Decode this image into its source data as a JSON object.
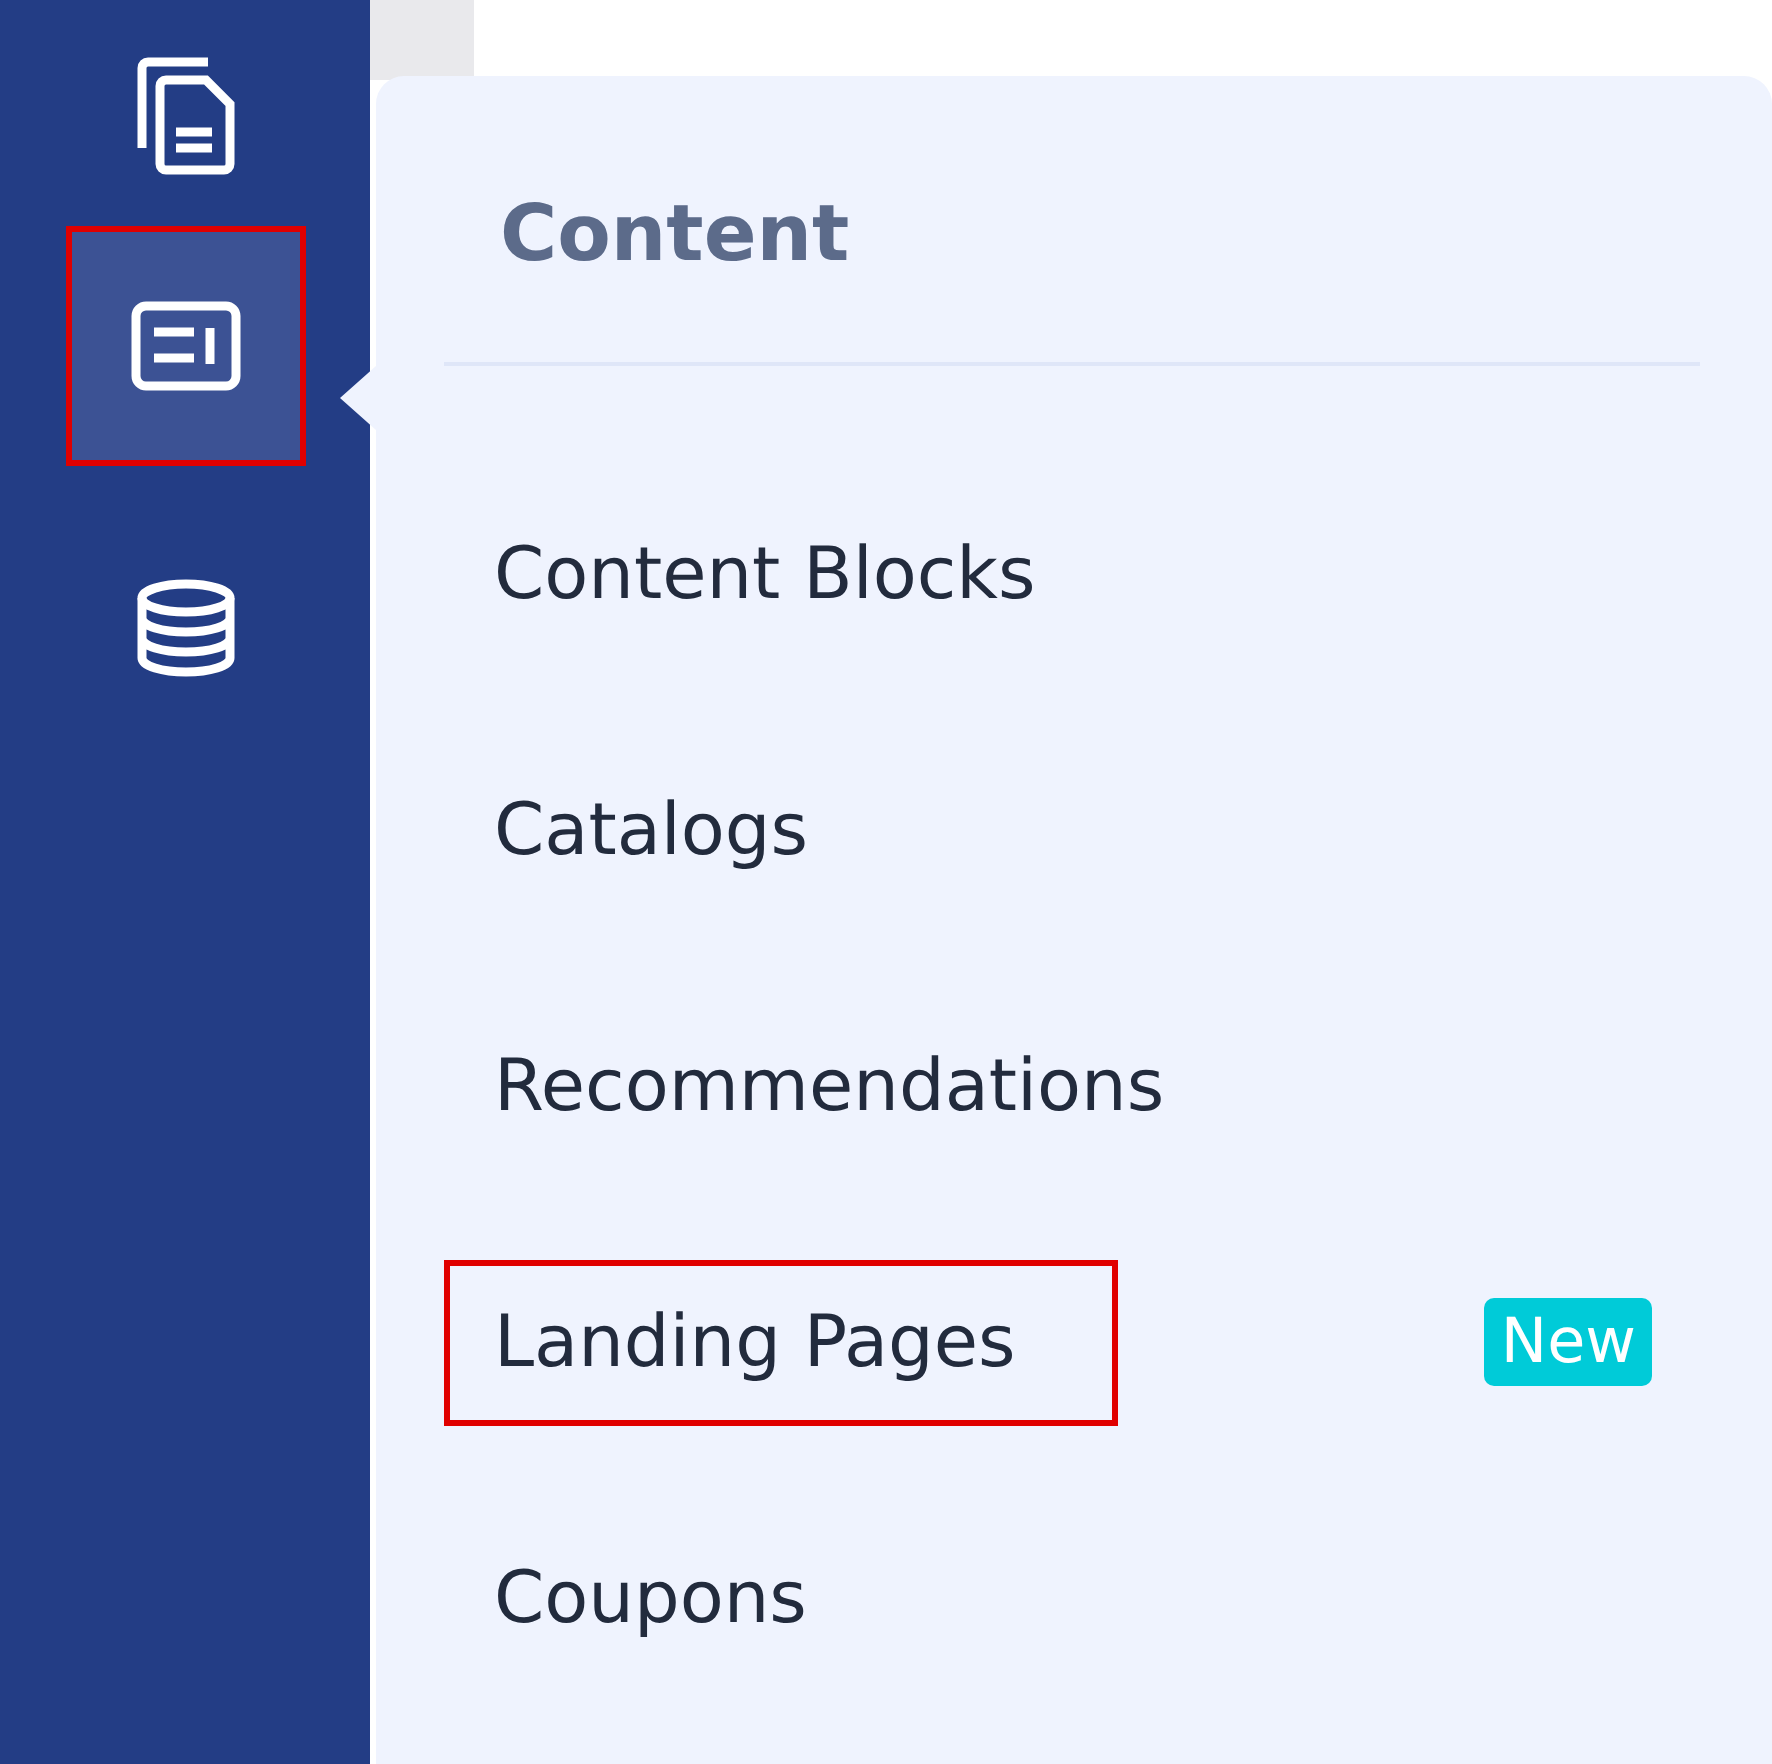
{
  "sidebar": {
    "items": [
      {
        "kind": "pages",
        "selected": false,
        "highlighted": false
      },
      {
        "kind": "content",
        "selected": true,
        "highlighted": true
      },
      {
        "kind": "database",
        "selected": false,
        "highlighted": false
      }
    ]
  },
  "menu": {
    "title": "Content",
    "items": [
      {
        "label": "Content Blocks",
        "highlighted": false
      },
      {
        "label": "Catalogs",
        "highlighted": false
      },
      {
        "label": "Recommendations",
        "highlighted": false
      },
      {
        "label": "Landing Pages",
        "highlighted": true,
        "badge": "New"
      },
      {
        "label": "Coupons",
        "highlighted": false
      }
    ]
  }
}
